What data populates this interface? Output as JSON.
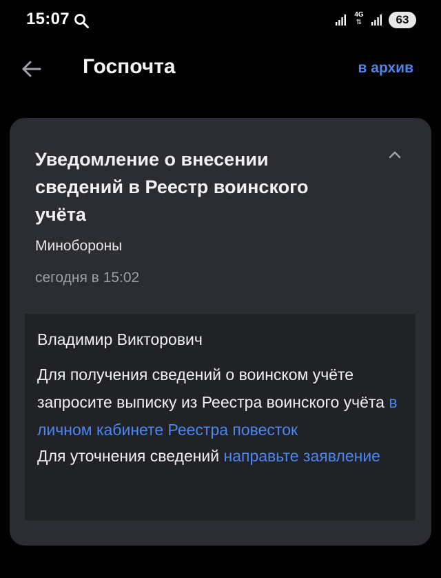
{
  "status_bar": {
    "time": "15:07",
    "network_type": "4G",
    "battery_level": "63"
  },
  "app_bar": {
    "title": "Госпочта",
    "archive_label": "в архив"
  },
  "message": {
    "title": "Уведомление о внесении сведений в Реестр воинского учёта",
    "sender": "Минобороны",
    "timestamp": "сегодня в 15:02",
    "greeting": "Владимир Викторович",
    "paragraph1_text": "Для получения сведений о воинском учёте запросите выписку из Реестра воинского учёта ",
    "paragraph1_link": "в личном кабинете Реестра повесток",
    "paragraph2_text": "Для уточнения сведений ",
    "paragraph2_link": "направьте заявление"
  },
  "colors": {
    "background": "#000000",
    "card": "#2b2d33",
    "body_box": "#202226",
    "link": "#4c86f0",
    "muted_text": "#9b9fa8"
  },
  "icons": {
    "back": "arrow-left-icon",
    "collapse": "chevron-up-icon",
    "search": "search-icon",
    "signal": "signal-icon"
  }
}
